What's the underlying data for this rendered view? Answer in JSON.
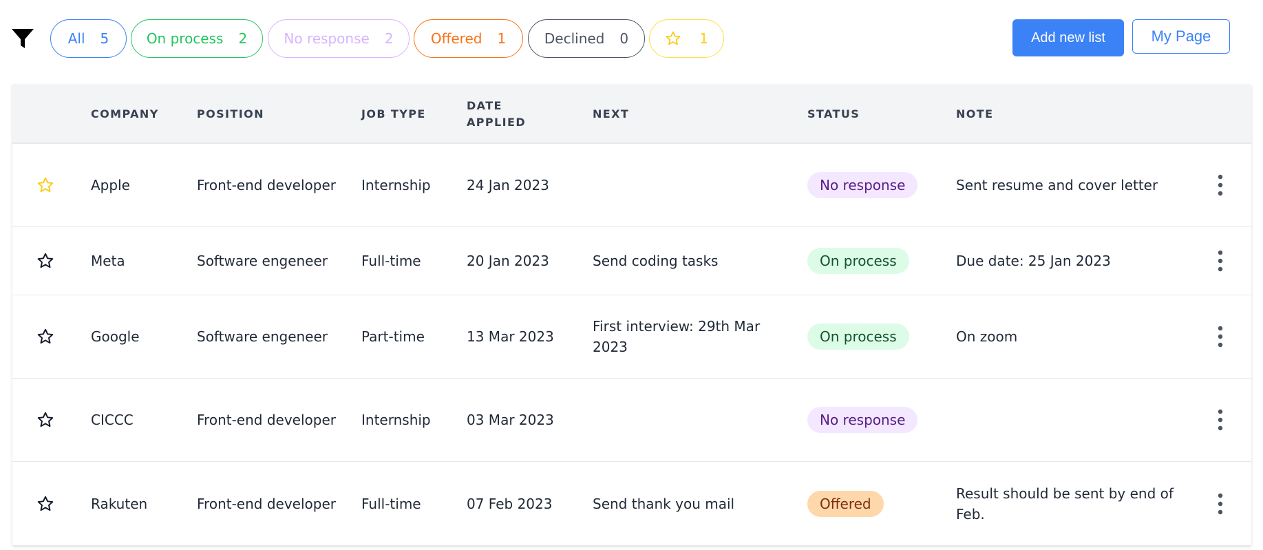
{
  "filters": {
    "all": {
      "label": "All",
      "count": "5"
    },
    "on_process": {
      "label": "On process",
      "count": "2"
    },
    "no_response": {
      "label": "No response",
      "count": "2"
    },
    "offered": {
      "label": "Offered",
      "count": "1"
    },
    "declined": {
      "label": "Declined",
      "count": "0"
    },
    "starred": {
      "icon": "star-outline-icon",
      "count": "1"
    }
  },
  "header_buttons": {
    "add_new_list": "Add new list",
    "my_page": "My Page"
  },
  "table": {
    "columns": {
      "company": "COMPANY",
      "position": "POSITION",
      "job_type": "JOB TYPE",
      "date_applied": "DATE APPLIED",
      "next": "NEXT",
      "status": "STATUS",
      "note": "NOTE"
    },
    "rows": [
      {
        "starred": true,
        "company": "Apple",
        "position": "Front-end developer",
        "job_type": "Internship",
        "date_applied": "24 Jan 2023",
        "next": "",
        "status": "No response",
        "note": "Sent resume and cover letter"
      },
      {
        "starred": false,
        "company": "Meta",
        "position": "Software engeneer",
        "job_type": "Full-time",
        "date_applied": "20 Jan 2023",
        "next": "Send coding tasks",
        "status": "On process",
        "note": "Due date: 25 Jan 2023"
      },
      {
        "starred": false,
        "company": "Google",
        "position": "Software engeneer",
        "job_type": "Part-time",
        "date_applied": "13 Mar 2023",
        "next": "First interview: 29th Mar 2023",
        "status": "On process",
        "note": "On zoom"
      },
      {
        "starred": false,
        "company": "CICCC",
        "position": "Front-end developer",
        "job_type": "Internship",
        "date_applied": "03 Mar 2023",
        "next": "",
        "status": "No response",
        "note": ""
      },
      {
        "starred": false,
        "company": "Rakuten",
        "position": "Front-end developer",
        "job_type": "Full-time",
        "date_applied": "07 Feb 2023",
        "next": "Send thank you mail",
        "status": "Offered",
        "note": "Result should be sent by end of Feb."
      }
    ]
  },
  "colors": {
    "accent": "#3b82f6",
    "on_process": "#22c55e",
    "no_response": "#d8b4fe",
    "offered": "#f97316",
    "declined": "#4b5563",
    "starred": "#facc15"
  }
}
